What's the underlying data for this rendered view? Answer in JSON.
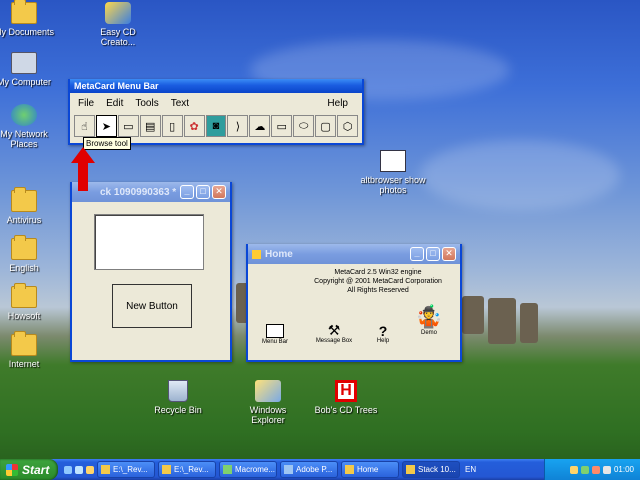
{
  "desktop_icons": [
    {
      "label": "My Documents",
      "icon": "my-documents-icon"
    },
    {
      "label": "Easy CD Creato...",
      "icon": "easy-cd-creator-icon"
    },
    {
      "label": "My Computer",
      "icon": "my-computer-icon"
    },
    {
      "label": "My Network Places",
      "icon": "network-places-icon"
    },
    {
      "label": "altbrowser show photos",
      "icon": "altbrowser-icon"
    },
    {
      "label": "Antivirus",
      "icon": "folder-icon"
    },
    {
      "label": "English",
      "icon": "folder-icon"
    },
    {
      "label": "Howsoft",
      "icon": "folder-icon"
    },
    {
      "label": "Internet",
      "icon": "folder-icon"
    },
    {
      "label": "Recycle Bin",
      "icon": "recycle-bin-icon"
    },
    {
      "label": "Windows Explorer",
      "icon": "windows-explorer-icon"
    },
    {
      "label": "Bob's CD Trees",
      "icon": "cd-trees-icon"
    }
  ],
  "menu_window": {
    "title": "MetaCard Menu Bar",
    "menus": [
      "File",
      "Edit",
      "Tools",
      "Text"
    ],
    "help": "Help",
    "tooltip": "Browse tool",
    "tools": [
      "browse-tool-icon",
      "pointer-tool-icon",
      "button-tool-icon",
      "field-tool-icon",
      "scrollbar-tool-icon",
      "image-tool-icon",
      "player-tool-icon",
      "graphic-tool-icon",
      "irregular-tool-icon",
      "rectangle-tool-icon",
      "oval-tool-icon",
      "rounded-rect-tool-icon",
      "polygon-tool-icon"
    ]
  },
  "stack_window": {
    "title": "ck 1090990363 *",
    "button_label": "New Button"
  },
  "home_window": {
    "title": "Home",
    "engine": "MetaCard 2.5 Win32 engine",
    "copyright": "Copyright @ 2001 MetaCard Corporation",
    "rights": "All Rights Reserved",
    "buttons": [
      "Menu Bar",
      "Message Box",
      "Help",
      "Demo"
    ]
  },
  "taskbar": {
    "start": "Start",
    "tasks": [
      "E:\\_Rev...",
      "E:\\_Rev...",
      "Macrome...",
      "Adobe P...",
      "Home",
      "Stack 10..."
    ],
    "lang": "EN",
    "clock": "01:00"
  },
  "colors": {
    "titlebar": "#0a44c9",
    "window_face": "#ece9d8",
    "arrow": "#e00000"
  }
}
